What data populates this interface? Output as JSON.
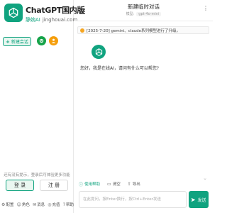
{
  "brand": {
    "title": "ChatGPT国内版",
    "author": "静婉AI",
    "domain": "jinghouai.com",
    "logo_icon": "openai-logo-icon",
    "accent": "#10a37f"
  },
  "sidebar": {
    "new_chat_label": "新建会话",
    "icons": [
      "settings-icon",
      "user-icon"
    ],
    "login_hint": "还有没有提示，登录后可体验更多功能",
    "login_label": "登 录",
    "register_label": "注 册",
    "footer": [
      {
        "icon": "settings-icon",
        "label": "配置"
      },
      {
        "icon": "role-icon",
        "label": "角色"
      },
      {
        "icon": "message-icon",
        "label": "消息"
      },
      {
        "icon": "recharge-icon",
        "label": "充值"
      },
      {
        "icon": "help-icon",
        "label": "帮助"
      }
    ]
  },
  "header": {
    "title": "新建临时对话",
    "model_label": "模型:",
    "model_value": "gpt-4o-mini"
  },
  "notice": {
    "text": "[2025-7-20] gemini、claude系列模型进行了升级。"
  },
  "chat": {
    "bot_message": "您好，我是在线AI，请问有什么可以帮您?"
  },
  "composer": {
    "tools": [
      {
        "icon": "help-icon",
        "label": "使用帮助"
      },
      {
        "icon": "clear-icon",
        "label": "清空"
      },
      {
        "icon": "export-icon",
        "label": "导出"
      }
    ],
    "placeholder": "在此提问，按Enter换行，按Ctrl+Enter发送",
    "send_label": "发送"
  }
}
